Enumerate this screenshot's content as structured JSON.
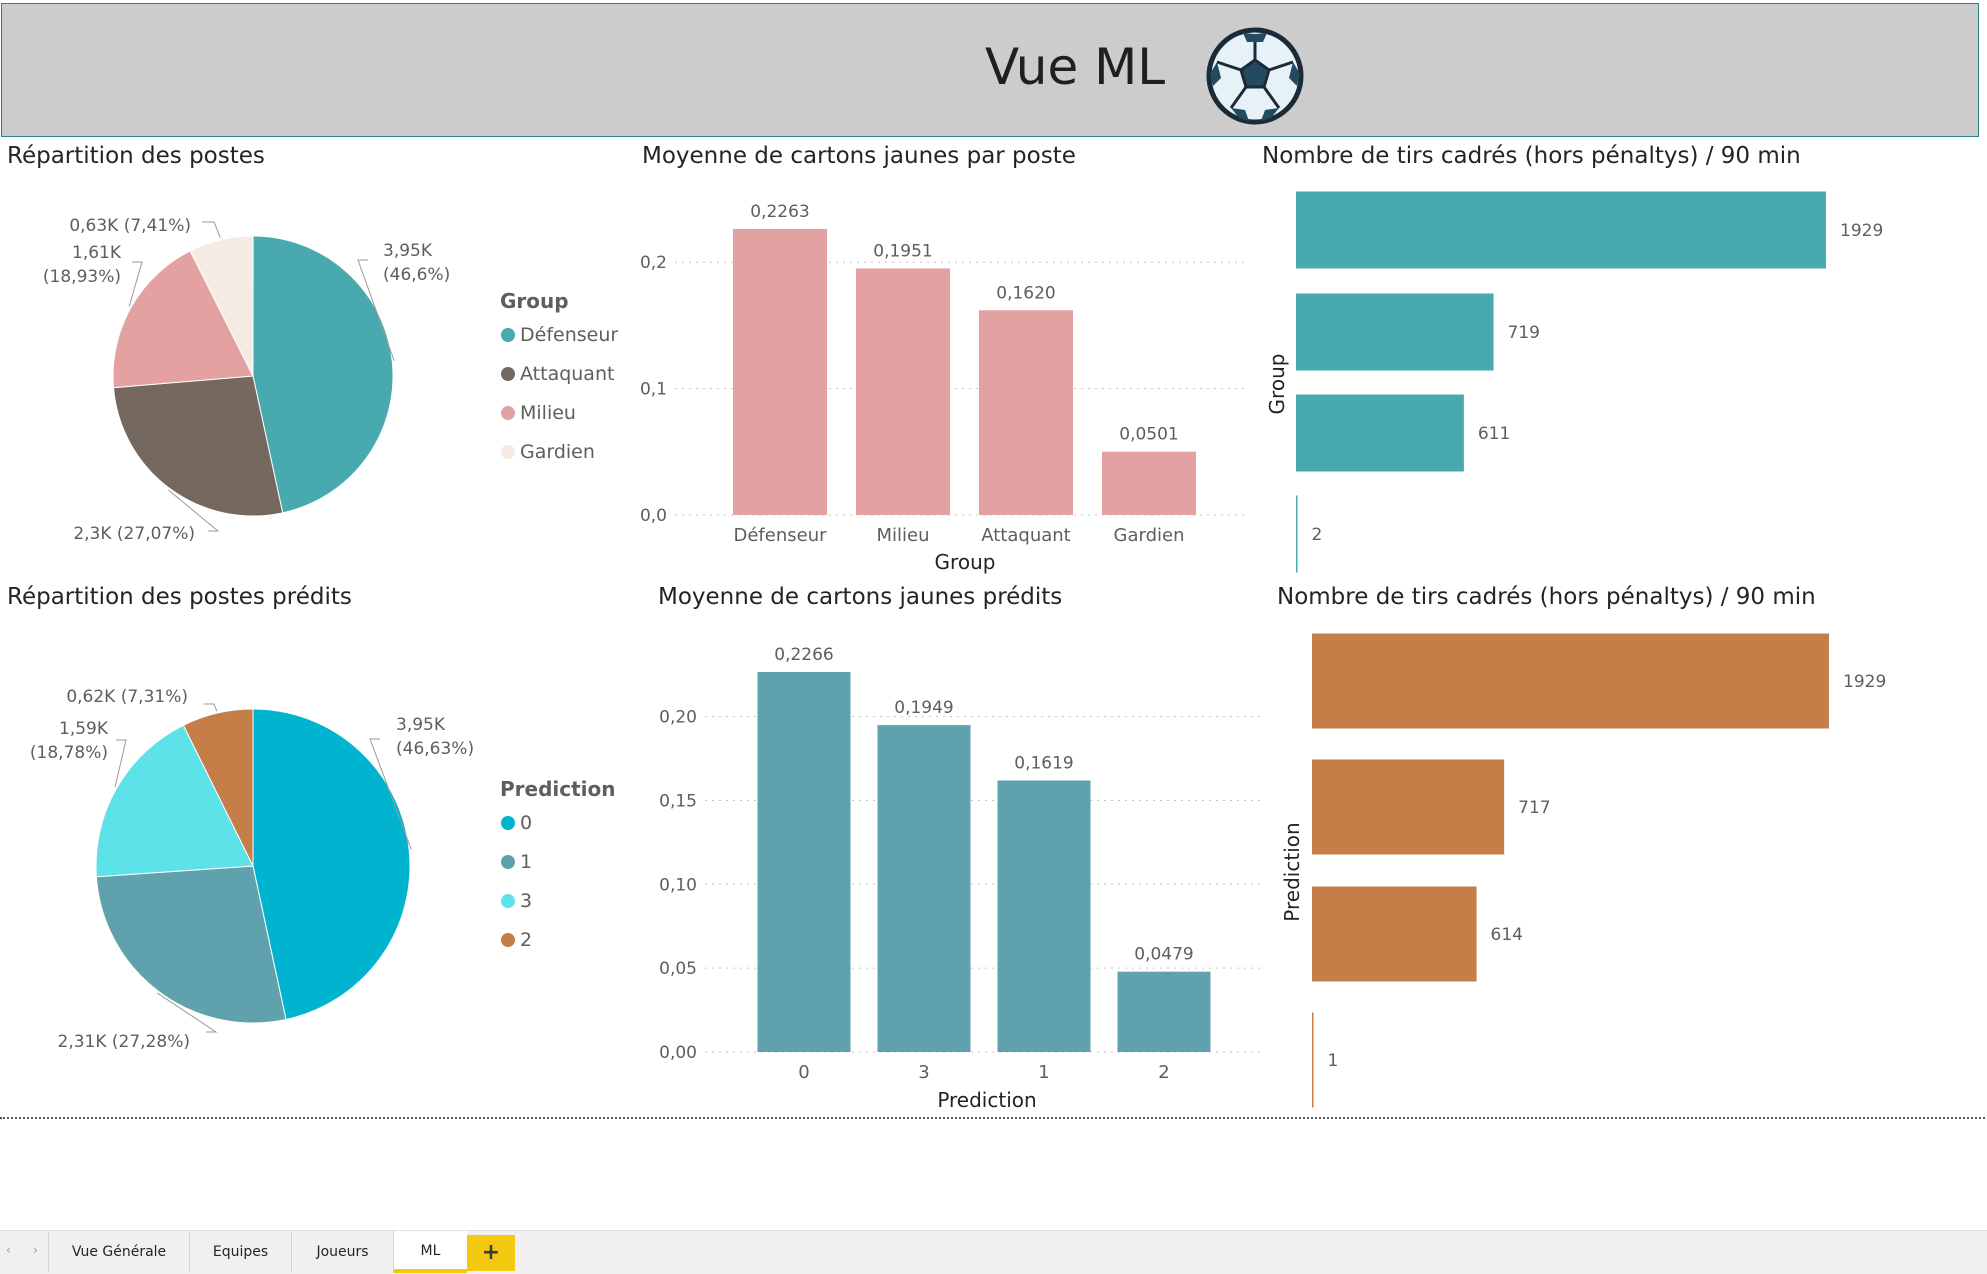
{
  "header": {
    "title": "Vue ML"
  },
  "icons": {
    "logo": "soccer-ball-icon",
    "add": "plus-icon",
    "prev": "chevron-left-icon",
    "next": "chevron-right-icon"
  },
  "colors": {
    "teal": "#48a9ae",
    "brown": "#75695f",
    "pink": "#e4a1a2",
    "cream": "#f5ebe4",
    "cyan": "#00b4cf",
    "slate": "#5fa2ae",
    "aqua": "#5ce2e8",
    "orange": "#c57e48",
    "accent": "#f2c811"
  },
  "tabs": [
    {
      "label": "Vue Générale"
    },
    {
      "label": "Equipes"
    },
    {
      "label": "Joueurs"
    },
    {
      "label": "ML",
      "active": true
    }
  ],
  "add_tab_label": "+",
  "nav": {
    "prev": "‹",
    "next": "›"
  },
  "chart_data": [
    {
      "type": "pie",
      "title": "Répartition des postes",
      "legend_title": "Group",
      "slices": [
        {
          "name": "Défenseur",
          "value": 3950,
          "label1": "3,95K",
          "label2": "(46,6%)",
          "share": 46.6,
          "color": "#48a9ae"
        },
        {
          "name": "Attaquant",
          "value": 2300,
          "label1": "2,3K (27,07%)",
          "label2": "",
          "share": 27.07,
          "color": "#75695f"
        },
        {
          "name": "Milieu",
          "value": 1610,
          "label1": "1,61K",
          "label2": "(18,93%)",
          "share": 18.93,
          "color": "#e4a1a2"
        },
        {
          "name": "Gardien",
          "value": 630,
          "label1": "0,63K (7,41%)",
          "label2": "",
          "share": 7.41,
          "color": "#f5ebe4"
        }
      ],
      "legend_position": "right"
    },
    {
      "type": "bar",
      "title": "Moyenne de cartons jaunes par poste",
      "xlabel": "Group",
      "categories": [
        "Défenseur",
        "Milieu",
        "Attaquant",
        "Gardien"
      ],
      "values": [
        0.2263,
        0.1951,
        0.162,
        0.0501
      ],
      "value_labels": [
        "0,2263",
        "0,1951",
        "0,1620",
        "0,0501"
      ],
      "yticks": [
        0,
        0.1,
        0.2
      ],
      "ytick_labels": [
        "0,0",
        "0,1",
        "0,2"
      ],
      "ylim": [
        0,
        0.2263
      ],
      "color": "#e4a1a2",
      "grid": true
    },
    {
      "type": "bar",
      "orientation": "horizontal",
      "title": "Nombre de tirs cadrés (hors pénaltys) / 90 min",
      "ylabel": "Group",
      "values": [
        1929,
        719,
        611,
        2
      ],
      "value_labels": [
        "1929",
        "719",
        "611",
        "2"
      ],
      "xlim": [
        0,
        1929
      ],
      "color": "#48a9ae"
    },
    {
      "type": "pie",
      "title": "Répartition des postes prédits",
      "legend_title": "Prediction",
      "slices": [
        {
          "name": "0",
          "value": 3950,
          "label1": "3,95K",
          "label2": "(46,63%)",
          "share": 46.63,
          "color": "#00b4cf"
        },
        {
          "name": "1",
          "value": 2310,
          "label1": "2,31K (27,28%)",
          "label2": "",
          "share": 27.28,
          "color": "#5fa2ae"
        },
        {
          "name": "3",
          "value": 1590,
          "label1": "1,59K",
          "label2": "(18,78%)",
          "share": 18.78,
          "color": "#5ce2e8"
        },
        {
          "name": "2",
          "value": 620,
          "label1": "0,62K (7,31%)",
          "label2": "",
          "share": 7.31,
          "color": "#c57e48"
        }
      ],
      "legend_position": "right"
    },
    {
      "type": "bar",
      "title": "Moyenne de cartons jaunes prédits",
      "xlabel": "Prediction",
      "categories": [
        "0",
        "3",
        "1",
        "2"
      ],
      "values": [
        0.2266,
        0.1949,
        0.1619,
        0.0479
      ],
      "value_labels": [
        "0,2266",
        "0,1949",
        "0,1619",
        "0,0479"
      ],
      "yticks": [
        0,
        0.05,
        0.1,
        0.15,
        0.2
      ],
      "ytick_labels": [
        "0,00",
        "0,05",
        "0,10",
        "0,15",
        "0,20"
      ],
      "ylim": [
        0,
        0.2266
      ],
      "color": "#5fa2ae",
      "grid": true
    },
    {
      "type": "bar",
      "orientation": "horizontal",
      "title": "Nombre de tirs cadrés (hors pénaltys) / 90 min",
      "ylabel": "Prediction",
      "values": [
        1929,
        717,
        614,
        1
      ],
      "value_labels": [
        "1929",
        "717",
        "614",
        "1"
      ],
      "xlim": [
        0,
        1929
      ],
      "color": "#c57e48"
    }
  ]
}
